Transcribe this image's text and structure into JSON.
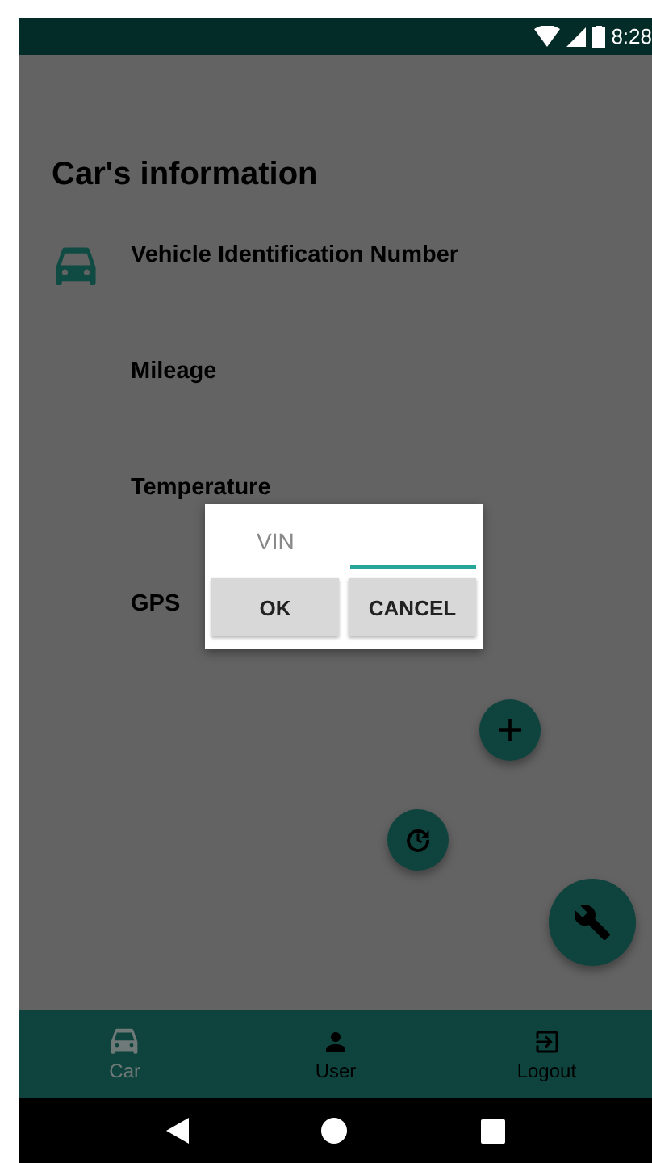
{
  "status_bar": {
    "time": "8:28"
  },
  "title": "Car's information",
  "fields": [
    {
      "label": "Vehicle Identification Number",
      "kind": "car"
    },
    {
      "label": "Mileage"
    },
    {
      "label": "Temperature"
    },
    {
      "label": "GPS"
    }
  ],
  "dialog": {
    "label": "VIN",
    "buttons": [
      "OK",
      "CANCEL"
    ]
  },
  "fabs": [
    {
      "kind": "add"
    },
    {
      "kind": "history"
    },
    {
      "kind": "wrench"
    }
  ],
  "bottom_nav": [
    {
      "label": "Car",
      "kind": "car",
      "selected": true
    },
    {
      "label": "User",
      "kind": "user",
      "selected": false
    },
    {
      "label": "Logout",
      "kind": "logout",
      "selected": false
    }
  ]
}
